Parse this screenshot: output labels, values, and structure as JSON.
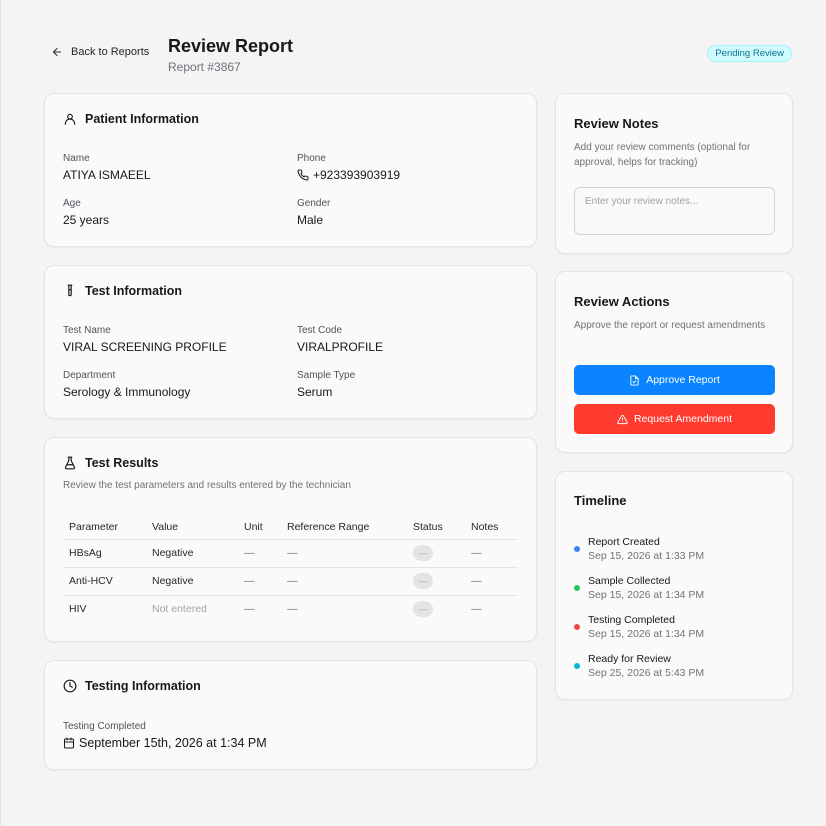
{
  "header": {
    "back_label": "Back to Reports",
    "title": "Review Report",
    "report_id": "Report #3867",
    "status_badge": "Pending Review",
    "badge_color": "#cffafe"
  },
  "patient": {
    "heading": "Patient Information",
    "name_label": "Name",
    "name": "ATIYA ISMAEEL",
    "phone_label": "Phone",
    "phone": "+923393903919",
    "age_label": "Age",
    "age": "25 years",
    "gender_label": "Gender",
    "gender": "Male"
  },
  "test": {
    "heading": "Test Information",
    "name_label": "Test Name",
    "name": "VIRAL SCREENING PROFILE",
    "code_label": "Test Code",
    "code": "VIRALPROFILE",
    "department_label": "Department",
    "department": "Serology & Immunology",
    "sample_label": "Sample Type",
    "sample": "Serum"
  },
  "results": {
    "heading": "Test Results",
    "subtitle": "Review the test parameters and results entered by the technician",
    "columns": [
      "Parameter",
      "Value",
      "Unit",
      "Reference Range",
      "Status",
      "Notes"
    ],
    "rows": [
      {
        "parameter": "HBsAg",
        "value": "Negative",
        "unit": "—",
        "range": "—",
        "status": "—",
        "notes": "—"
      },
      {
        "parameter": "Anti-HCV",
        "value": "Negative",
        "unit": "—",
        "range": "—",
        "status": "—",
        "notes": "—"
      },
      {
        "parameter": "HIV",
        "value": "Not entered",
        "unit": "—",
        "range": "—",
        "status": "—",
        "notes": "—"
      }
    ]
  },
  "testing": {
    "heading": "Testing Information",
    "label": "Testing Completed",
    "date": "September 15th, 2026 at 1:34 PM"
  },
  "notes": {
    "heading": "Review Notes",
    "subtitle": "Add your review comments (optional for approval, helps for tracking)",
    "placeholder": "Enter your review notes..."
  },
  "actions": {
    "heading": "Review Actions",
    "subtitle": "Approve the report or request amendments",
    "approve_label": "Approve Report",
    "amend_label": "Request Amendment",
    "approve_color": "#0a84ff",
    "amend_color": "#ff3b30"
  },
  "timeline": {
    "heading": "Timeline",
    "items": [
      {
        "title": "Report Created",
        "time": "Sep 15, 2026 at 1:33 PM",
        "color": "#3b82f6"
      },
      {
        "title": "Sample Collected",
        "time": "Sep 15, 2026 at 1:34 PM",
        "color": "#22c55e"
      },
      {
        "title": "Testing Completed",
        "time": "Sep 15, 2026 at 1:34 PM",
        "color": "#ef4444"
      },
      {
        "title": "Ready for Review",
        "time": "Sep 25, 2026 at 5:43 PM",
        "color": "#06b6d4"
      }
    ]
  }
}
